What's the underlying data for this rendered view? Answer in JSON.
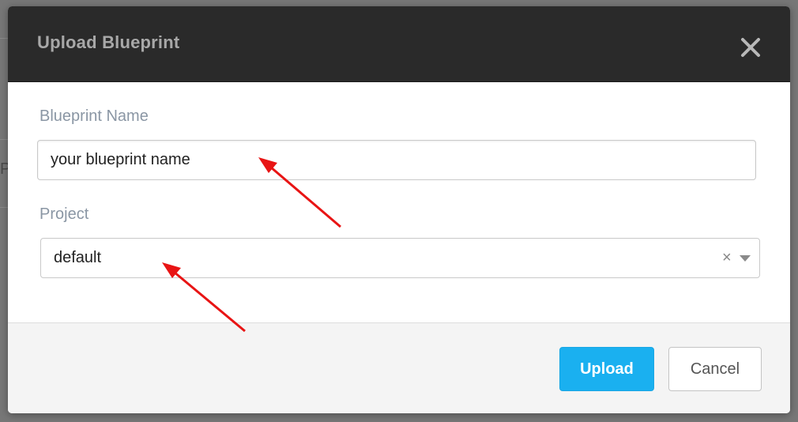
{
  "dialog": {
    "title": "Upload Blueprint",
    "close_label": "×"
  },
  "form": {
    "blueprint_name_label": "Blueprint Name",
    "blueprint_name_value": "your blueprint name",
    "project_label": "Project",
    "project_value": "default",
    "project_clear_label": "×"
  },
  "footer": {
    "upload_label": "Upload",
    "cancel_label": "Cancel"
  },
  "background": {
    "partial_char": "P"
  },
  "colors": {
    "header_bg": "#2a2a2a",
    "primary_button": "#1ab0f0",
    "annotation_arrow": "#e81414"
  },
  "icons": [
    "close-icon",
    "clear-icon",
    "chevron-down-icon",
    "annotation-arrow"
  ]
}
